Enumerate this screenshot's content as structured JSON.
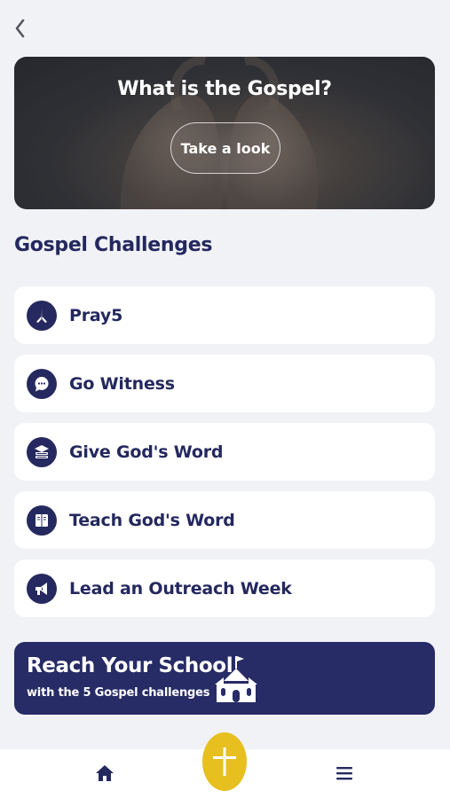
{
  "header": {
    "back_icon": "chevron-left-icon"
  },
  "hero": {
    "title": "What is the Gospel?",
    "button_label": "Take a look"
  },
  "section": {
    "title": "Gospel Challenges"
  },
  "challenges": [
    {
      "label": "Pray5",
      "icon": "praying-hands-icon"
    },
    {
      "label": "Go Witness",
      "icon": "chat-bubble-icon"
    },
    {
      "label": "Give God's Word",
      "icon": "book-stack-icon"
    },
    {
      "label": "Teach God's Word",
      "icon": "open-book-icon"
    },
    {
      "label": "Lead an Outreach Week",
      "icon": "megaphone-icon"
    }
  ],
  "banner": {
    "title": "Reach Your School",
    "subtitle": "with the 5 Gospel challenges",
    "icon": "school-icon"
  },
  "tabbar": {
    "home_icon": "home-icon",
    "add_icon": "plus-icon",
    "menu_icon": "hamburger-menu-icon"
  },
  "colors": {
    "navy": "#25295f",
    "accent_yellow": "#e7bf1f",
    "background": "#f1f2f6",
    "card": "#ffffff"
  }
}
